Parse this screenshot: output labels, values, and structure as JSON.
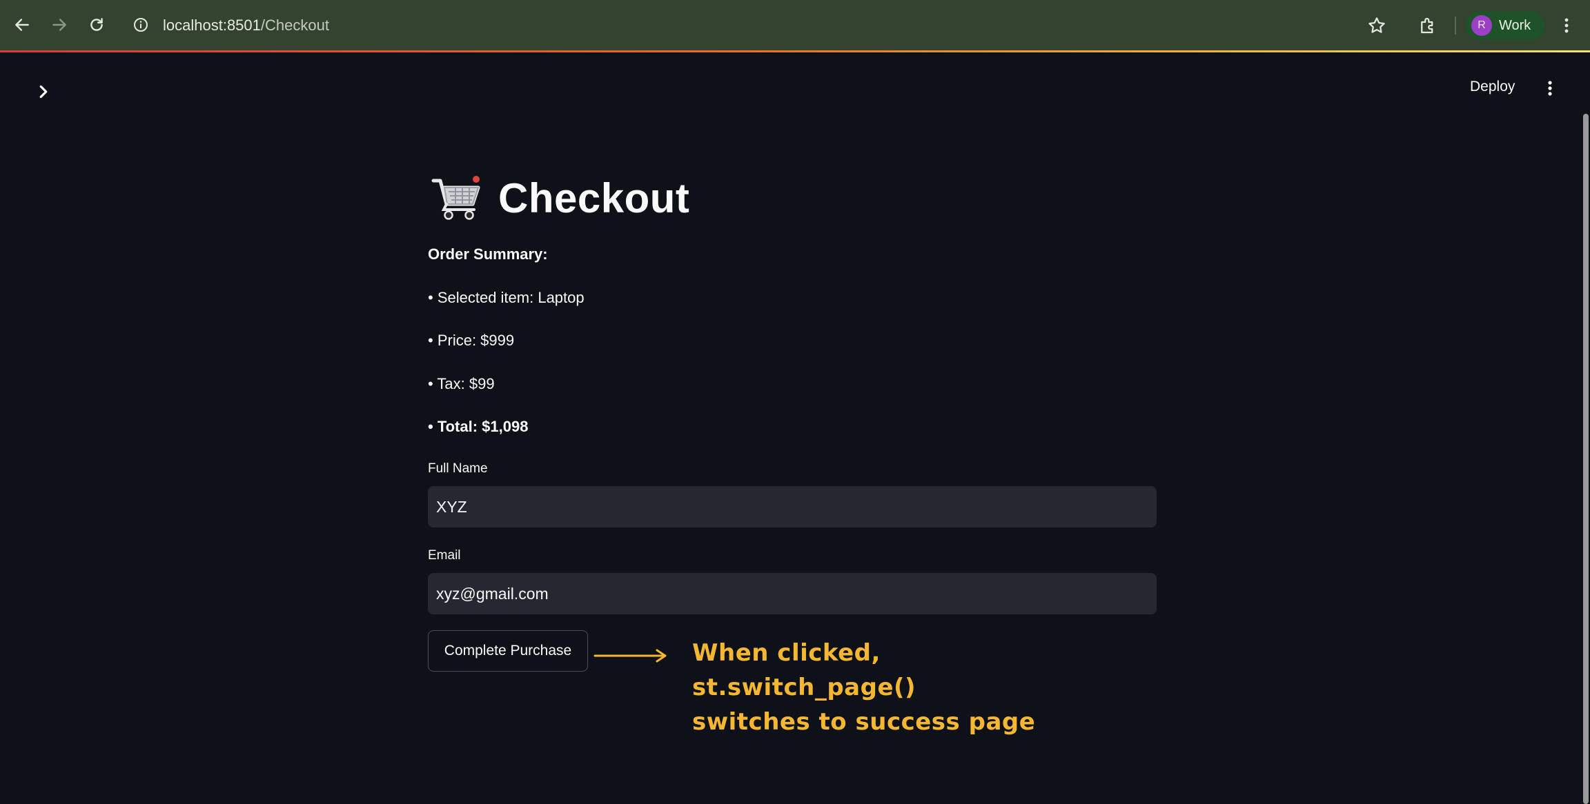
{
  "browser": {
    "url_host": "localhost:8501",
    "url_path": "/Checkout",
    "profile": {
      "initial": "R",
      "label": "Work",
      "avatar_color": "#9b3fc6"
    },
    "icons": [
      "back-arrow-icon",
      "forward-arrow-icon",
      "reload-icon",
      "info-icon",
      "star-icon",
      "extensions-icon",
      "more-vertical-icon"
    ]
  },
  "app_header": {
    "deploy_label": "Deploy"
  },
  "page": {
    "title_emoji": "🛒",
    "title": "Checkout",
    "summary_heading": "Order Summary:",
    "summary_items": [
      {
        "text": "• Selected item: Laptop",
        "bold": false
      },
      {
        "text": "• Price: $999",
        "bold": false
      },
      {
        "text": "• Tax: $99",
        "bold": false
      },
      {
        "text": "• Total: $1,098",
        "bold": true
      }
    ],
    "fields": [
      {
        "label": "Full Name",
        "value": "XYZ"
      },
      {
        "label": "Email",
        "value": "xyz@gmail.com"
      }
    ],
    "submit_label": "Complete Purchase"
  },
  "annotation": {
    "lines": [
      "When clicked,",
      "st.switch_page()",
      "switches to success page"
    ],
    "color": "#f5b731"
  },
  "colors": {
    "background": "#0e1117",
    "input_bg": "#262730",
    "chrome_bg": "#34432f"
  }
}
